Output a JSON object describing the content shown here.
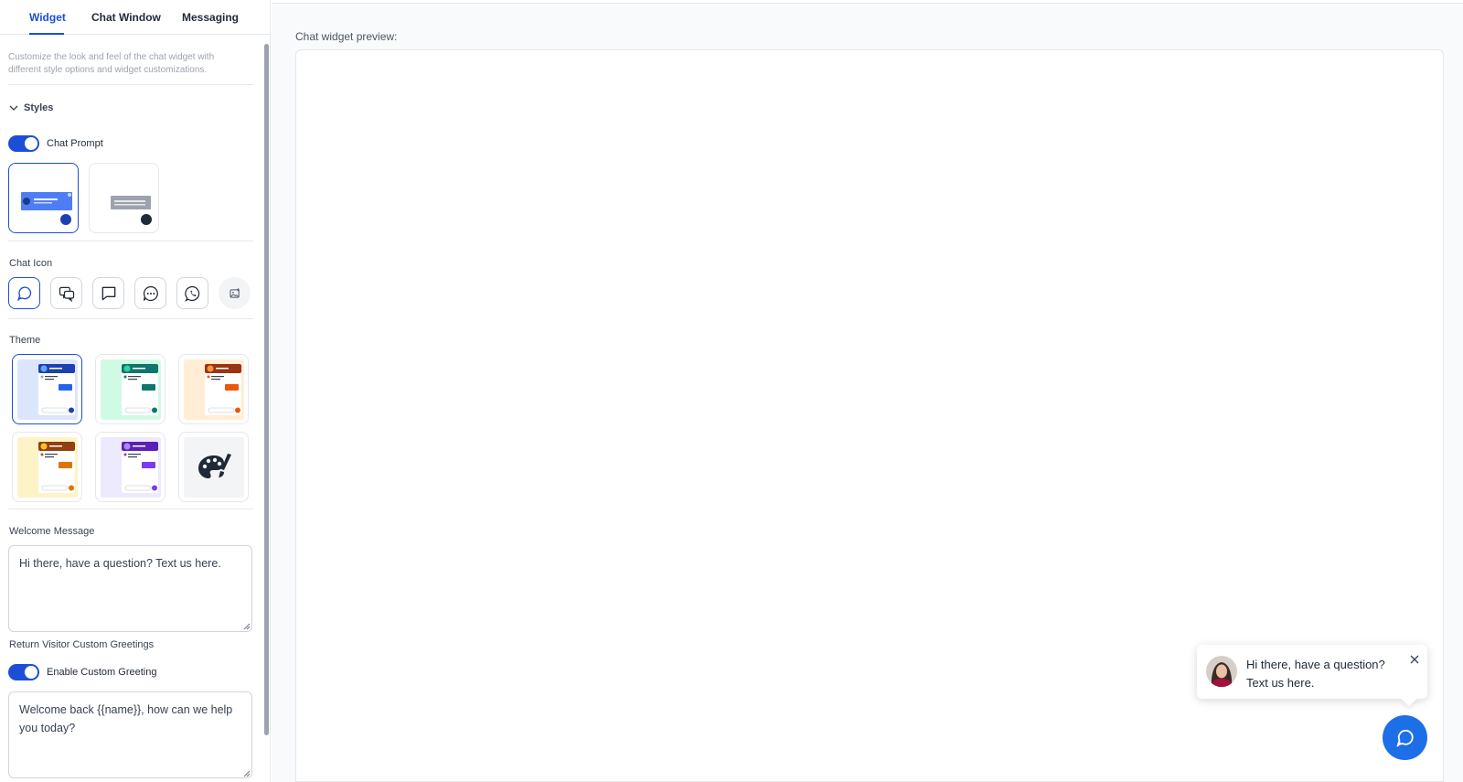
{
  "tabs": [
    {
      "label": "Widget",
      "active": true
    },
    {
      "label": "Chat Window",
      "active": false
    },
    {
      "label": "Messaging",
      "active": false
    }
  ],
  "sidebar": {
    "description": "Customize the look and feel of the chat widget with different style options and widget customizations.",
    "styles_section": "Styles",
    "chat_prompt_label": "Chat Prompt",
    "chat_prompt_enabled": true,
    "prompt_styles": [
      "blue-bubble",
      "gray-bubble"
    ],
    "chat_icon_label": "Chat Icon",
    "chat_icons": [
      "chat-bubble-icon",
      "double-chat-icon",
      "square-chat-icon",
      "dots-chat-icon",
      "whatsapp-icon",
      "upload-image-icon"
    ],
    "theme_label": "Theme",
    "themes": [
      {
        "name": "blue",
        "bg": "#dbe6fd",
        "accent": "#1e40af"
      },
      {
        "name": "green",
        "bg": "#d1fae5",
        "accent": "#0f766e"
      },
      {
        "name": "orange",
        "bg": "#ffedd5",
        "accent": "#c2410c"
      },
      {
        "name": "yellow",
        "bg": "#fef3c7",
        "accent": "#b45309"
      },
      {
        "name": "purple",
        "bg": "#ede9fe",
        "accent": "#6d28d9"
      },
      {
        "name": "custom",
        "icon": "palette-icon"
      }
    ],
    "welcome_label": "Welcome Message",
    "welcome_value": "Hi there, have a question? Text us here.",
    "return_visitor_label": "Return Visitor Custom Greetings",
    "custom_greeting_label": "Enable Custom Greeting",
    "custom_greeting_enabled": true,
    "custom_greeting_value": "Welcome back {{name}}, how can we help you today?"
  },
  "preview": {
    "label": "Chat widget preview:",
    "bubble_text": "Hi there, have a question? Text us here.",
    "launcher_color": "#1d6fe8"
  },
  "colors": {
    "accent": "#1d4ed8",
    "border": "#e5e7eb"
  }
}
